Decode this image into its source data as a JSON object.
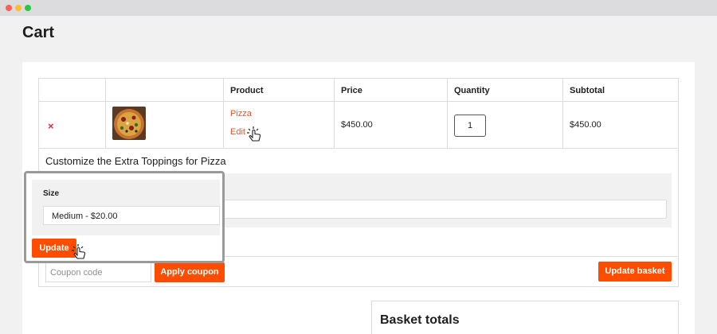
{
  "window": {
    "controls": [
      "close",
      "minimize",
      "maximize"
    ]
  },
  "page": {
    "title": "Cart"
  },
  "table": {
    "headers": [
      "",
      "",
      "Product",
      "Price",
      "Quantity",
      "Subtotal"
    ],
    "row": {
      "remove_symbol": "×",
      "product_name": "Pizza",
      "edit_label": "Edit",
      "price": "$450.00",
      "quantity": "1",
      "subtotal": "$450.00"
    }
  },
  "customize": {
    "title": "Customize the Extra Toppings for Pizza"
  },
  "coupon": {
    "placeholder": "Coupon code",
    "apply_label": "Apply coupon"
  },
  "actions": {
    "update_basket_label": "Update basket"
  },
  "totals": {
    "title": "Basket totals"
  },
  "popup": {
    "size_label": "Size",
    "size_value": "Medium - $20.00",
    "update_label": "Update"
  },
  "colors": {
    "accent": "#ff4d00",
    "link": "#e4572e",
    "remove": "#d63638"
  },
  "icons": [
    "pizza-thumbnail",
    "hand-pointer-click-icon"
  ]
}
